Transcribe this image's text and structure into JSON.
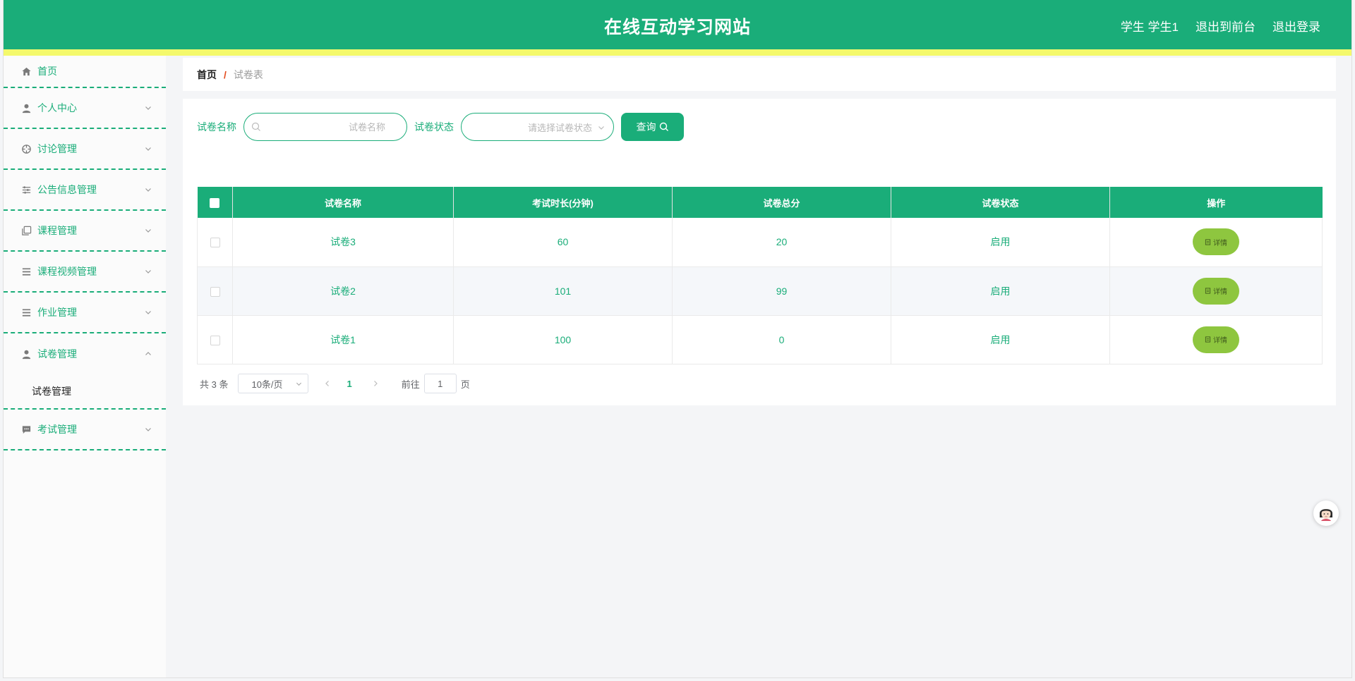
{
  "header": {
    "title": "在线互动学习网站",
    "user_label": "学生 学生1",
    "to_front_label": "退出到前台",
    "logout_label": "退出登录"
  },
  "sidebar": {
    "items": [
      {
        "label": "首页",
        "icon": "home-icon"
      },
      {
        "label": "个人中心",
        "icon": "user-icon"
      },
      {
        "label": "讨论管理",
        "icon": "crosshair-icon"
      },
      {
        "label": "公告信息管理",
        "icon": "sliders-icon"
      },
      {
        "label": "课程管理",
        "icon": "copy-icon"
      },
      {
        "label": "课程视频管理",
        "icon": "list-icon"
      },
      {
        "label": "作业管理",
        "icon": "list-icon"
      },
      {
        "label": "试卷管理",
        "icon": "user-icon",
        "expanded": true
      },
      {
        "label": "考试管理",
        "icon": "chat-icon"
      }
    ],
    "submenu_label": "试卷管理"
  },
  "breadcrumb": {
    "home": "首页",
    "separator": "/",
    "current": "试卷表"
  },
  "search": {
    "name_label": "试卷名称",
    "name_placeholder": "试卷名称",
    "status_label": "试卷状态",
    "status_placeholder": "请选择试卷状态",
    "query_label": "查询"
  },
  "table": {
    "columns": [
      "试卷名称",
      "考试时长(分钟)",
      "试卷总分",
      "试卷状态",
      "操作"
    ],
    "rows": [
      {
        "name": "试卷3",
        "duration": "60",
        "score": "20",
        "status": "启用",
        "action": "详情"
      },
      {
        "name": "试卷2",
        "duration": "101",
        "score": "99",
        "status": "启用",
        "action": "详情"
      },
      {
        "name": "试卷1",
        "duration": "100",
        "score": "0",
        "status": "启用",
        "action": "详情"
      }
    ]
  },
  "pagination": {
    "total_text": "共 3 条",
    "page_size": "10条/页",
    "current_page": "1",
    "goto_label": "前往",
    "goto_value": "1",
    "page_suffix": "页"
  },
  "colors": {
    "primary": "#1aad79",
    "accent_stripe": "#f4f96c",
    "detail_button": "#8ec63f"
  }
}
